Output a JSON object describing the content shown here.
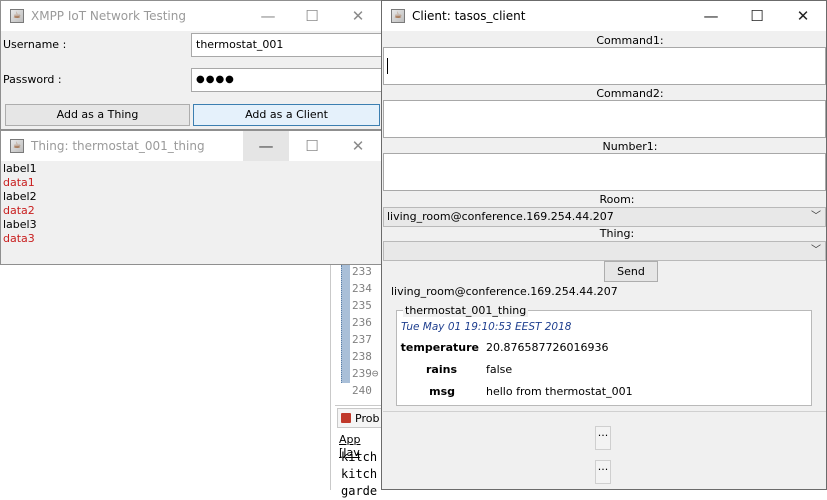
{
  "background_ide": {
    "gutter_lines": [
      "233",
      "234",
      "235",
      "236",
      "237",
      "238",
      "239⊖",
      "240"
    ],
    "panel_tab": "Prob",
    "console_label": "App [Jav",
    "console_lines": [
      "kitch",
      "kitch",
      "garde"
    ]
  },
  "main_window": {
    "title": "XMPP IoT Network Testing",
    "username_label": "Username :",
    "username_value": "thermostat_001",
    "password_label": "Password :",
    "password_value": "●●●●",
    "add_thing_label": "Add as a Thing",
    "add_client_label": "Add as a Client"
  },
  "thing_window": {
    "title": "Thing: thermostat_001_thing",
    "rows": [
      "label1",
      "data1",
      "label2",
      "data2",
      "label3",
      "data3"
    ]
  },
  "client_window": {
    "title": "Client: tasos_client",
    "command1_label": "Command1:",
    "command1_value": "",
    "command2_label": "Command2:",
    "command2_value": "",
    "number1_label": "Number1:",
    "number1_value": "",
    "room_label": "Room:",
    "room_value": "living_room@conference.169.254.44.207",
    "thing_label": "Thing:",
    "thing_value": "",
    "send_label": "Send",
    "room_header": "living_room@conference.169.254.44.207",
    "message": {
      "sender": "thermostat_001_thing",
      "timestamp": "Tue May 01 19:10:53 EEST 2018",
      "fields": [
        {
          "key": "temperature",
          "value": "20.876587726016936"
        },
        {
          "key": "rains",
          "value": "false"
        },
        {
          "key": "msg",
          "value": "hello from thermostat_001"
        }
      ]
    },
    "more_button_1": "...",
    "more_button_2": "..."
  },
  "window_controls": {
    "minimize": "—",
    "maximize": "☐",
    "close": "✕"
  },
  "colors": {
    "data_red": "#c81e1e",
    "timestamp_blue": "#1f3f8f",
    "focus_button": "#e5f1fb"
  }
}
